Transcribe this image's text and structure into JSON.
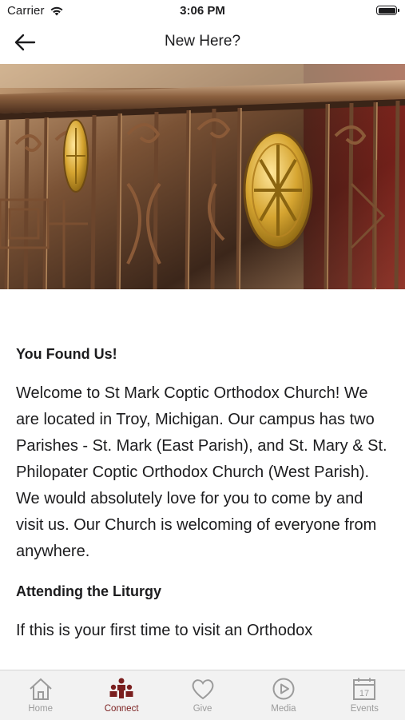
{
  "status_bar": {
    "carrier": "Carrier",
    "time": "3:06 PM"
  },
  "nav": {
    "title": "New Here?"
  },
  "hero": {
    "alt": "ornate bronze church railing with golden cross medallions"
  },
  "content": {
    "heading1": "You Found Us!",
    "para1": "Welcome to St Mark Coptic Orthodox Church!  We are located in Troy, Michigan. Our campus has two Parishes - St. Mark (East Parish), and St. Mary & St. Philopater Coptic Orthodox Church (West Parish). We would absolutely love for you to come by and visit us. Our Church is welcoming of everyone from anywhere.",
    "heading2": "Attending the Liturgy",
    "para2": "If this is your first time to visit an Orthodox"
  },
  "tab_bar": {
    "active_color": "#7a1f1f",
    "inactive_color": "#9b9b9b",
    "tabs": [
      {
        "label": "Home",
        "icon": "home-icon"
      },
      {
        "label": "Connect",
        "icon": "people-icon"
      },
      {
        "label": "Give",
        "icon": "heart-icon"
      },
      {
        "label": "Media",
        "icon": "play-icon"
      },
      {
        "label": "Events",
        "icon": "calendar-icon"
      }
    ],
    "calendar_day": "17"
  }
}
